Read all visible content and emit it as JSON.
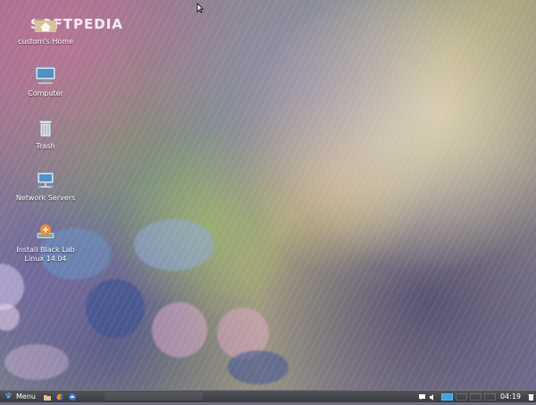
{
  "desktop": {
    "watermark": "SOFTPEDIA",
    "icons": [
      {
        "label": "custom's Home",
        "icon": "home-folder-icon"
      },
      {
        "label": "Computer",
        "icon": "computer-icon"
      },
      {
        "label": "Trash",
        "icon": "trash-icon"
      },
      {
        "label": "Network Servers",
        "icon": "network-servers-icon"
      },
      {
        "label_line1": "Install Black Lab",
        "label_line2": "Linux 14.04",
        "icon": "install-disk-icon"
      }
    ]
  },
  "taskbar": {
    "menu_label": "Menu",
    "clock": "04:19",
    "workspace_count": "4",
    "active_workspace": "1",
    "launchers": [
      "folder-icon",
      "firefox-icon",
      "thunderbird-icon"
    ],
    "tray": [
      "chat-icon",
      "volume-icon",
      "trash-icon"
    ]
  },
  "colors": {
    "taskbar": "#46474c",
    "accent": "#43a3d8",
    "text": "#ffffff"
  }
}
